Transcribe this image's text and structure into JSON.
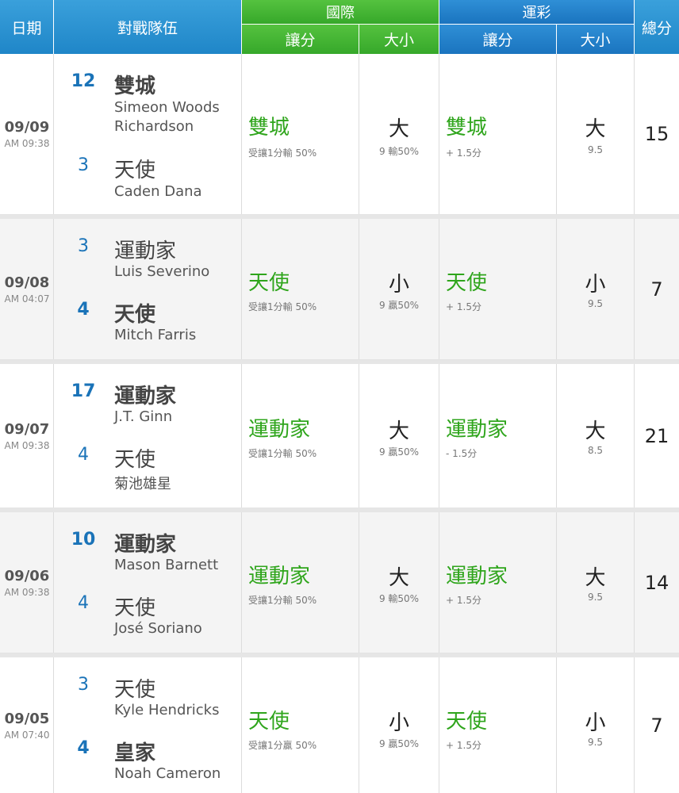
{
  "header": {
    "date": "日期",
    "teams": "對戰隊伍",
    "intl_group": "國際",
    "intl_handicap": "讓分",
    "intl_ou": "大小",
    "sport_group": "運彩",
    "sport_handicap": "讓分",
    "sport_ou": "大小",
    "total": "總分"
  },
  "colors": {
    "header_blue": "#2a93d5",
    "header_green": "#45b535",
    "pick_green": "#2fa51c",
    "score_blue": "#1a73b8"
  },
  "games": [
    {
      "date": "09/09",
      "time": "AM 09:38",
      "away_score": "12",
      "away_team": "雙城",
      "away_pitcher": "Simeon Woods Richardson",
      "home_score": "3",
      "home_team": "天使",
      "home_pitcher": "Caden Dana",
      "intl_pick": "雙城",
      "intl_pick_note": "受讓1分輸 50%",
      "intl_ou": "大",
      "intl_ou_note": "9  輸50%",
      "sport_pick": "雙城",
      "sport_pick_note": "+ 1.5分",
      "sport_ou": "大",
      "sport_ou_note": "9.5",
      "total": "15"
    },
    {
      "date": "09/08",
      "time": "AM 04:07",
      "away_score": "3",
      "away_team": "運動家",
      "away_pitcher": "Luis Severino",
      "home_score": "4",
      "home_team": "天使",
      "home_pitcher": "Mitch Farris",
      "intl_pick": "天使",
      "intl_pick_note": "受讓1分輸 50%",
      "intl_ou": "小",
      "intl_ou_note": "9  贏50%",
      "sport_pick": "天使",
      "sport_pick_note": "+ 1.5分",
      "sport_ou": "小",
      "sport_ou_note": "9.5",
      "total": "7"
    },
    {
      "date": "09/07",
      "time": "AM 09:38",
      "away_score": "17",
      "away_team": "運動家",
      "away_pitcher": "J.T. Ginn",
      "home_score": "4",
      "home_team": "天使",
      "home_pitcher": "菊池雄星",
      "intl_pick": "運動家",
      "intl_pick_note": "受讓1分輸 50%",
      "intl_ou": "大",
      "intl_ou_note": "9  贏50%",
      "sport_pick": "運動家",
      "sport_pick_note": "- 1.5分",
      "sport_ou": "大",
      "sport_ou_note": "8.5",
      "total": "21"
    },
    {
      "date": "09/06",
      "time": "AM 09:38",
      "away_score": "10",
      "away_team": "運動家",
      "away_pitcher": "Mason Barnett",
      "home_score": "4",
      "home_team": "天使",
      "home_pitcher": "José Soriano",
      "intl_pick": "運動家",
      "intl_pick_note": "受讓1分輸 50%",
      "intl_ou": "大",
      "intl_ou_note": "9  輸50%",
      "sport_pick": "運動家",
      "sport_pick_note": "+ 1.5分",
      "sport_ou": "大",
      "sport_ou_note": "9.5",
      "total": "14"
    },
    {
      "date": "09/05",
      "time": "AM 07:40",
      "away_score": "3",
      "away_team": "天使",
      "away_pitcher": "Kyle Hendricks",
      "home_score": "4",
      "home_team": "皇家",
      "home_pitcher": "Noah Cameron",
      "intl_pick": "天使",
      "intl_pick_note": "受讓1分贏 50%",
      "intl_ou": "小",
      "intl_ou_note": "9  贏50%",
      "sport_pick": "天使",
      "sport_pick_note": "+ 1.5分",
      "sport_ou": "小",
      "sport_ou_note": "9.5",
      "total": "7"
    }
  ]
}
